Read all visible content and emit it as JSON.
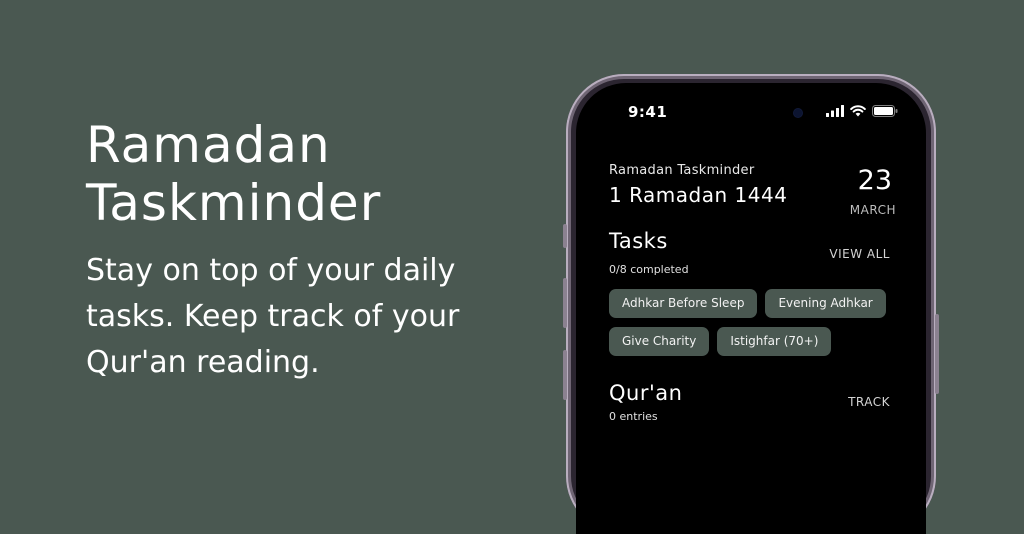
{
  "promo": {
    "title_line1": "Ramadan",
    "title_line2": "Taskminder",
    "tagline": "Stay on top of your daily tasks. Keep track of your Qur'an reading."
  },
  "status_bar": {
    "time": "9:41",
    "icons": [
      "cellular-signal-icon",
      "wifi-icon",
      "battery-icon"
    ]
  },
  "header": {
    "app_name": "Ramadan Taskminder",
    "hijri_date": "1 Ramadan 1444",
    "day": "23",
    "month": "MARCH"
  },
  "tasks": {
    "title": "Tasks",
    "progress": "0/8 completed",
    "link": "VIEW ALL",
    "chips": [
      "Adhkar Before Sleep",
      "Evening Adhkar",
      "Give Charity",
      "Istighfar (70+)"
    ]
  },
  "quran": {
    "title": "Qur'an",
    "entries": "0 entries",
    "link": "TRACK"
  },
  "colors": {
    "background": "#4a5851",
    "chip": "#4a5851",
    "screen": "#000000",
    "phone_frame": "#b9aebf"
  }
}
